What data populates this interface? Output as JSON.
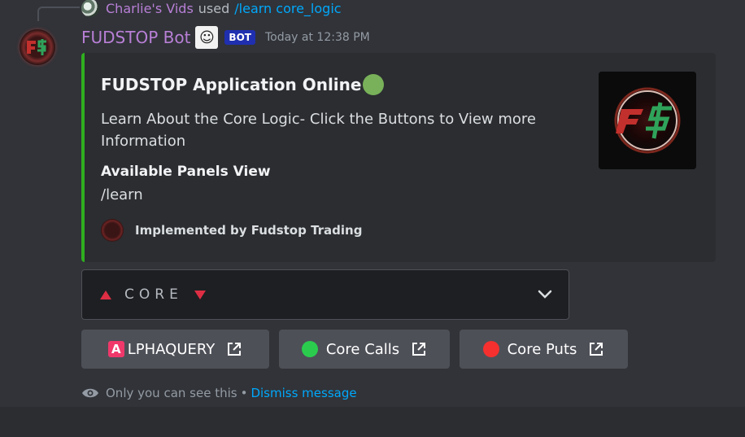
{
  "reply": {
    "user": "Charlie's Vids",
    "used": "used",
    "command": "/learn core_logic"
  },
  "message": {
    "bot_name": "FUDSTOP Bot",
    "bot_tag": "BOT",
    "timestamp": "Today at 12:38 PM"
  },
  "embed": {
    "accent_color": "#2faf1f",
    "title": "FUDSTOP Application Online",
    "title_emoji": "green-circle",
    "description": "Learn About the Core Logic- Click the Buttons to View more Information",
    "field_name": "Available Panels View",
    "field_value": "/learn",
    "footer_text": "Implemented by Fudstop Trading"
  },
  "select_menu": {
    "placeholder": "CORE",
    "left_icon": "red-triangle-up",
    "right_icon": "red-triangle-down"
  },
  "buttons": [
    {
      "emoji_letter": "A",
      "label": "LPHAQUERY",
      "emoji": "regional-indicator-a",
      "color": "#f0386b"
    },
    {
      "label": "Core Calls",
      "emoji": "green-circle",
      "color": "#2bcc4e"
    },
    {
      "label": "Core Puts",
      "emoji": "red-circle",
      "color": "#f5302f"
    }
  ],
  "ephemeral": {
    "text": "Only you can see this",
    "separator": "•",
    "dismiss": "Dismiss message"
  }
}
